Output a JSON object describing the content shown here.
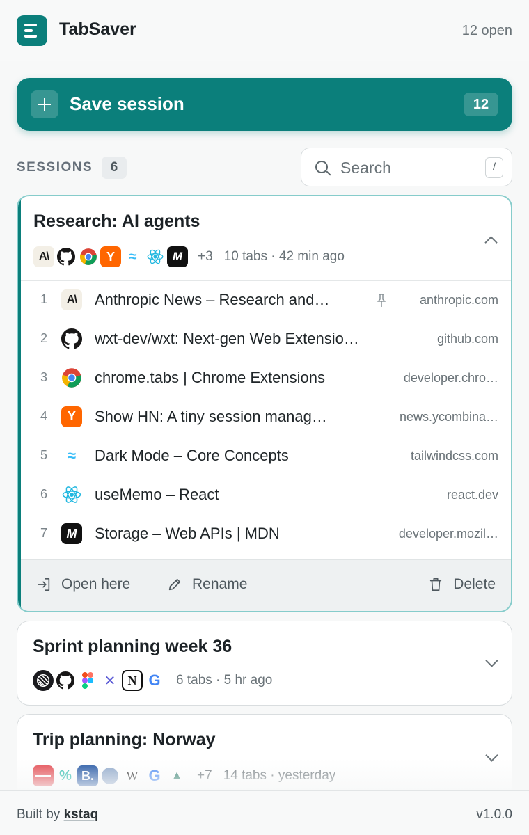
{
  "header": {
    "app_name": "TabSaver",
    "open_count": "12 open"
  },
  "save": {
    "label": "Save session",
    "count": "12"
  },
  "sessions": {
    "label": "SESSIONS",
    "count": "6",
    "search_placeholder": "Search",
    "search_shortcut": "/"
  },
  "cards": [
    {
      "title": "Research: AI agents",
      "extra": "+3",
      "meta": "10 tabs · 42 min ago",
      "favicons": [
        "anthropic",
        "github",
        "chrome",
        "ycombinator",
        "tailwind",
        "react",
        "mdn"
      ],
      "tabs": [
        {
          "num": "1",
          "title": "Anthropic News – Research and…",
          "domain": "anthropic.com",
          "favicon": "anthropic",
          "pinned": true
        },
        {
          "num": "2",
          "title": "wxt-dev/wxt: Next-gen Web Extensio…",
          "domain": "github.com",
          "favicon": "github",
          "pinned": false
        },
        {
          "num": "3",
          "title": "chrome.tabs | Chrome Extensions",
          "domain": "developer.chro…",
          "favicon": "chrome",
          "pinned": false
        },
        {
          "num": "4",
          "title": "Show HN: A tiny session manag…",
          "domain": "news.ycombina…",
          "favicon": "ycombinator",
          "pinned": false
        },
        {
          "num": "5",
          "title": "Dark Mode – Core Concepts",
          "domain": "tailwindcss.com",
          "favicon": "tailwind",
          "pinned": false
        },
        {
          "num": "6",
          "title": "useMemo – React",
          "domain": "react.dev",
          "favicon": "react",
          "pinned": false
        },
        {
          "num": "7",
          "title": "Storage – Web APIs | MDN",
          "domain": "developer.mozil…",
          "favicon": "mdn",
          "pinned": false
        }
      ],
      "actions": {
        "open": "Open here",
        "rename": "Rename",
        "delete": "Delete"
      }
    },
    {
      "title": "Sprint planning week 36",
      "meta": "6 tabs · 5 hr ago",
      "favicons": [
        "linear",
        "github",
        "figma",
        "vercel-tools",
        "notion",
        "google"
      ]
    },
    {
      "title": "Trip planning: Norway",
      "extra": "+7",
      "meta": "14 tabs · yesterday",
      "favicons": [
        "airline",
        "hopper",
        "booking",
        "globe",
        "wikipedia",
        "google",
        "maps"
      ]
    }
  ],
  "footer": {
    "built_by": "Built by",
    "author": "kstaq",
    "version": "v1.0.0"
  },
  "colors": {
    "accent": "#0b7f7b",
    "accent_border": "#86cccb"
  }
}
